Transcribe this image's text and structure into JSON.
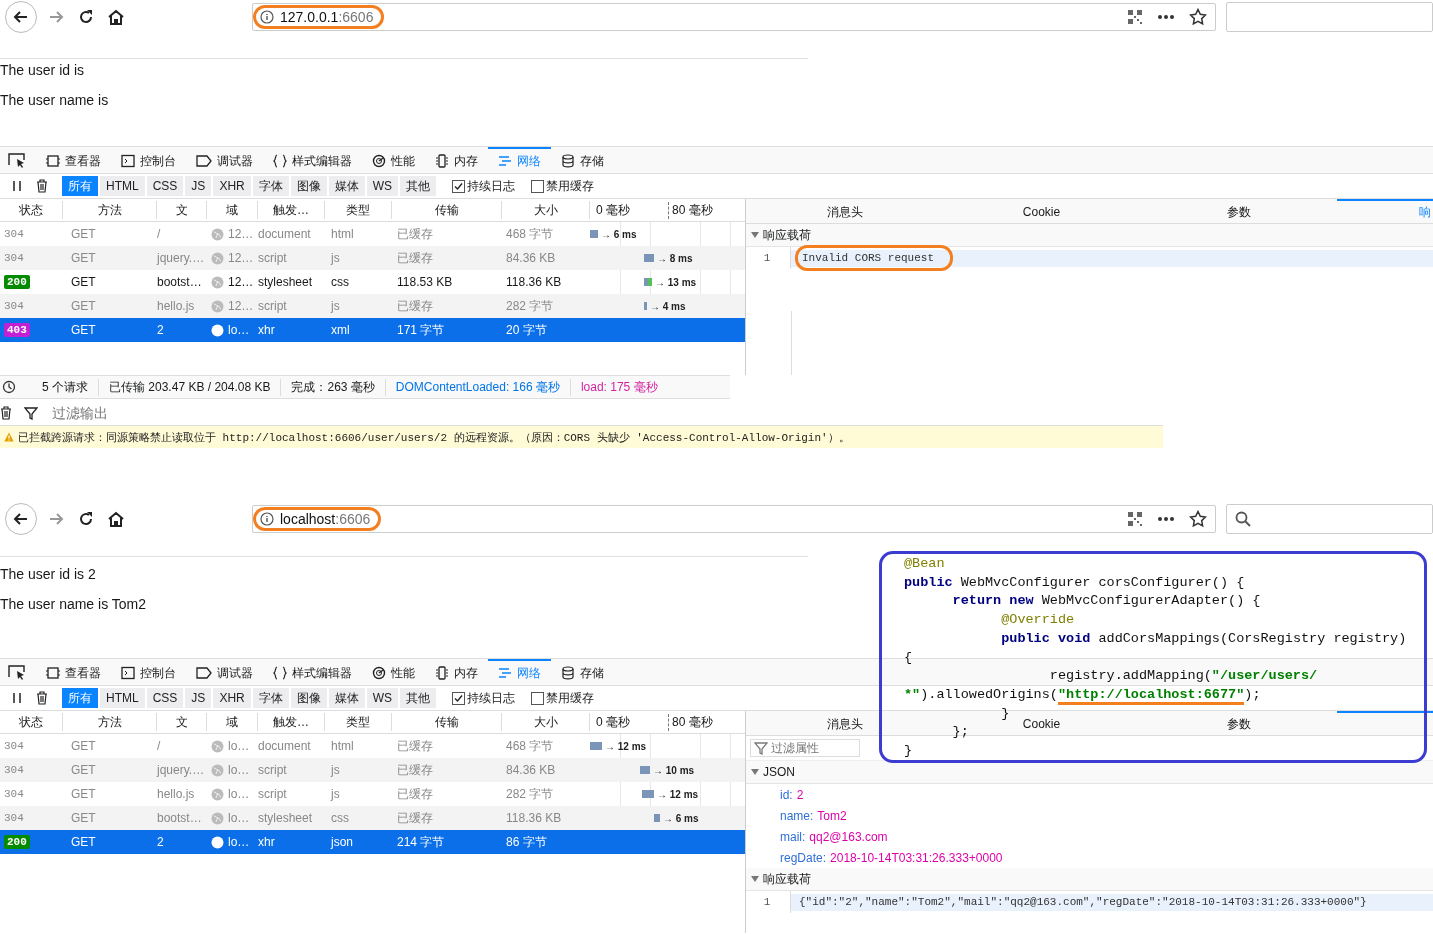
{
  "screens": [
    {
      "address": {
        "host": "127.0.0.1",
        "port": ":6606",
        "circled": true
      },
      "page_lines": [
        "The user id is",
        "The user name is"
      ],
      "devtools_tabs": [
        {
          "label": "查看器",
          "selected": false
        },
        {
          "label": "控制台",
          "selected": false
        },
        {
          "label": "调试器",
          "selected": false
        },
        {
          "label": "样式编辑器",
          "selected": false
        },
        {
          "label": "性能",
          "selected": false
        },
        {
          "label": "内存",
          "selected": false
        },
        {
          "label": "网络",
          "selected": true
        },
        {
          "label": "存储",
          "selected": false
        }
      ],
      "filters": [
        {
          "label": "所有",
          "selected": true
        },
        {
          "label": "HTML",
          "selected": false
        },
        {
          "label": "CSS",
          "selected": false
        },
        {
          "label": "JS",
          "selected": false
        },
        {
          "label": "XHR",
          "selected": false
        },
        {
          "label": "字体",
          "selected": false
        },
        {
          "label": "图像",
          "selected": false
        },
        {
          "label": "媒体",
          "selected": false
        },
        {
          "label": "WS",
          "selected": false
        },
        {
          "label": "其他",
          "selected": false
        }
      ],
      "checkboxes": [
        {
          "label": "持续日志",
          "checked": true
        },
        {
          "label": "禁用缓存",
          "checked": false
        }
      ],
      "columns": [
        "状态",
        "方法",
        "文",
        "域",
        "触发…",
        "类型",
        "传输",
        "大小",
        "0 毫秒",
        "80 毫秒"
      ],
      "rows": [
        {
          "status": "304",
          "method": "GET",
          "file": "/",
          "domain": "12…",
          "cause": "document",
          "type": "html",
          "transferred": "已缓存",
          "size": "468 字节",
          "timing": "→ 6 ms",
          "cached": true,
          "selected": false
        },
        {
          "status": "304",
          "method": "GET",
          "file": "jquery.…",
          "domain": "12…",
          "cause": "script",
          "type": "js",
          "transferred": "已缓存",
          "size": "84.36 KB",
          "timing": "→ 8 ms",
          "cached": true,
          "selected": false
        },
        {
          "status": "200",
          "color": "#058b00",
          "method": "GET",
          "file": "bootst…",
          "domain": "12…",
          "cause": "stylesheet",
          "type": "css",
          "transferred": "118.53 KB",
          "size": "118.36 KB",
          "timing": "→ 13 ms",
          "cached": false,
          "selected": false
        },
        {
          "status": "304",
          "method": "GET",
          "file": "hello.js",
          "domain": "12…",
          "cause": "script",
          "type": "js",
          "transferred": "已缓存",
          "size": "282 字节",
          "timing": "→ 4 ms",
          "cached": true,
          "selected": false
        },
        {
          "status": "403",
          "color": "#c31fd4",
          "method": "GET",
          "file": "2",
          "domain": "lo…",
          "cause": "xhr",
          "type": "xml",
          "transferred": "171 字节",
          "size": "20 字节",
          "cached": false,
          "selected": true
        }
      ],
      "panel_tabs": [
        {
          "label": "消息头",
          "selected": false
        },
        {
          "label": "Cookie",
          "selected": false
        },
        {
          "label": "参数",
          "selected": false
        },
        {
          "label": "响",
          "selected": true
        }
      ],
      "sections": [
        {
          "title": "响应载荷",
          "kind": "source",
          "lines": [
            {
              "number": "1",
              "text": "Invalid CORS request",
              "circled": true
            }
          ]
        }
      ],
      "status_bar": [
        {
          "text": "5 个请求",
          "kind": "plain"
        },
        {
          "text": "已传输 203.47 KB / 204.08 KB",
          "kind": "plain"
        },
        {
          "text": "完成：263 毫秒",
          "kind": "plain"
        },
        {
          "text": "DOMContentLoaded: 166 毫秒",
          "kind": "dom"
        },
        {
          "text": "load: 175 毫秒",
          "kind": "load"
        }
      ],
      "console": {
        "placeholder": "过滤输出",
        "warning": "已拦截跨源请求：同源策略禁止读取位于 http://localhost:6606/user/users/2 的远程资源。（原因：CORS 头缺少 'Access-Control-Allow-Origin'）。"
      }
    },
    {
      "address": {
        "host": "localhost",
        "port": ":6606",
        "circled": true
      },
      "page_lines": [
        "The user id is 2",
        "The user name is Tom2"
      ],
      "devtools_tabs": [
        {
          "label": "查看器",
          "selected": false
        },
        {
          "label": "控制台",
          "selected": false
        },
        {
          "label": "调试器",
          "selected": false
        },
        {
          "label": "样式编辑器",
          "selected": false
        },
        {
          "label": "性能",
          "selected": false
        },
        {
          "label": "内存",
          "selected": false
        },
        {
          "label": "网络",
          "selected": true
        },
        {
          "label": "存储",
          "selected": false
        }
      ],
      "filters": [
        {
          "label": "所有",
          "selected": true
        },
        {
          "label": "HTML",
          "selected": false
        },
        {
          "label": "CSS",
          "selected": false
        },
        {
          "label": "JS",
          "selected": false
        },
        {
          "label": "XHR",
          "selected": false
        },
        {
          "label": "字体",
          "selected": false
        },
        {
          "label": "图像",
          "selected": false
        },
        {
          "label": "媒体",
          "selected": false
        },
        {
          "label": "WS",
          "selected": false
        },
        {
          "label": "其他",
          "selected": false
        }
      ],
      "checkboxes": [
        {
          "label": "持续日志",
          "checked": true
        },
        {
          "label": "禁用缓存",
          "checked": false
        }
      ],
      "columns": [
        "状态",
        "方法",
        "文",
        "域",
        "触发…",
        "类型",
        "传输",
        "大小",
        "0 毫秒",
        "80 毫秒"
      ],
      "rows": [
        {
          "status": "304",
          "method": "GET",
          "file": "/",
          "domain": "lo…",
          "cause": "document",
          "type": "html",
          "transferred": "已缓存",
          "size": "468 字节",
          "timing": "→ 12 ms",
          "cached": true,
          "selected": false
        },
        {
          "status": "304",
          "method": "GET",
          "file": "jquery.…",
          "domain": "lo…",
          "cause": "script",
          "type": "js",
          "transferred": "已缓存",
          "size": "84.36 KB",
          "timing": "→ 10 ms",
          "cached": true,
          "selected": false
        },
        {
          "status": "304",
          "method": "GET",
          "file": "hello.js",
          "domain": "lo…",
          "cause": "script",
          "type": "js",
          "transferred": "已缓存",
          "size": "282 字节",
          "timing": "→ 12 ms",
          "cached": true,
          "selected": false
        },
        {
          "status": "304",
          "method": "GET",
          "file": "bootst…",
          "domain": "lo…",
          "cause": "stylesheet",
          "type": "css",
          "transferred": "已缓存",
          "size": "118.36 KB",
          "timing": "→ 6 ms",
          "cached": true,
          "selected": false
        },
        {
          "status": "200",
          "color": "#058b00",
          "method": "GET",
          "file": "2",
          "domain": "lo…",
          "cause": "xhr",
          "type": "json",
          "transferred": "214 字节",
          "size": "86 字节",
          "cached": false,
          "selected": true
        }
      ],
      "panel_tabs": [
        {
          "label": "消息头",
          "selected": false
        },
        {
          "label": "Cookie",
          "selected": false
        },
        {
          "label": "参数",
          "selected": false
        },
        {
          "selected": true
        }
      ],
      "filter_placeholder": "过滤属性",
      "sections": [
        {
          "title": "JSON",
          "kind": "tree",
          "props": [
            {
              "key": "id:",
              "value": "2"
            },
            {
              "key": "name:",
              "value": "Tom2"
            },
            {
              "key": "mail:",
              "value": "qq2@163.com"
            },
            {
              "key": "regDate:",
              "value": "2018-10-14T03:31:26.333+0000"
            }
          ]
        },
        {
          "title": "响应载荷",
          "kind": "source",
          "lines": [
            {
              "number": "1",
              "text": "{\"id\":\"2\",\"name\":\"Tom2\",\"mail\":\"qq2@163.com\",\"regDate\":\"2018-10-14T03:31:26.333+0000\"}",
              "circled": false
            }
          ]
        }
      ]
    }
  ],
  "code_callout": {
    "lines": [
      [
        {
          "kind": "annotation",
          "text": "@Bean"
        }
      ],
      [
        {
          "kind": "keyword",
          "text": "public"
        },
        {
          "kind": "plain",
          "text": " WebMvcConfigurer corsConfigurer() {"
        }
      ],
      [
        {
          "kind": "keyword",
          "text": "      return new"
        },
        {
          "kind": "plain",
          "text": " WebMvcConfigurerAdapter() {"
        }
      ],
      [
        {
          "kind": "annotation",
          "text": "            @Override"
        }
      ],
      [
        {
          "kind": "keyword",
          "text": "            public void"
        },
        {
          "kind": "plain",
          "text": " addCorsMappings(CorsRegistry registry)"
        }
      ],
      [
        {
          "kind": "plain",
          "text": "{"
        }
      ],
      [
        {
          "kind": "plain",
          "text": "                  registry.addMapping("
        },
        {
          "kind": "string",
          "text": "\"/user/users/"
        }
      ],
      [
        {
          "kind": "string",
          "text": "*\""
        },
        {
          "kind": "plain",
          "text": ").allowedOrigins("
        },
        {
          "kind": "string",
          "text": "\"http://localhost:6677\"",
          "underlined": true
        },
        {
          "kind": "plain",
          "text": ");"
        }
      ],
      [
        {
          "kind": "plain",
          "text": "            }"
        }
      ],
      [
        {
          "kind": "plain",
          "text": "      };"
        }
      ],
      [
        {
          "kind": "plain",
          "text": "}"
        }
      ]
    ]
  }
}
